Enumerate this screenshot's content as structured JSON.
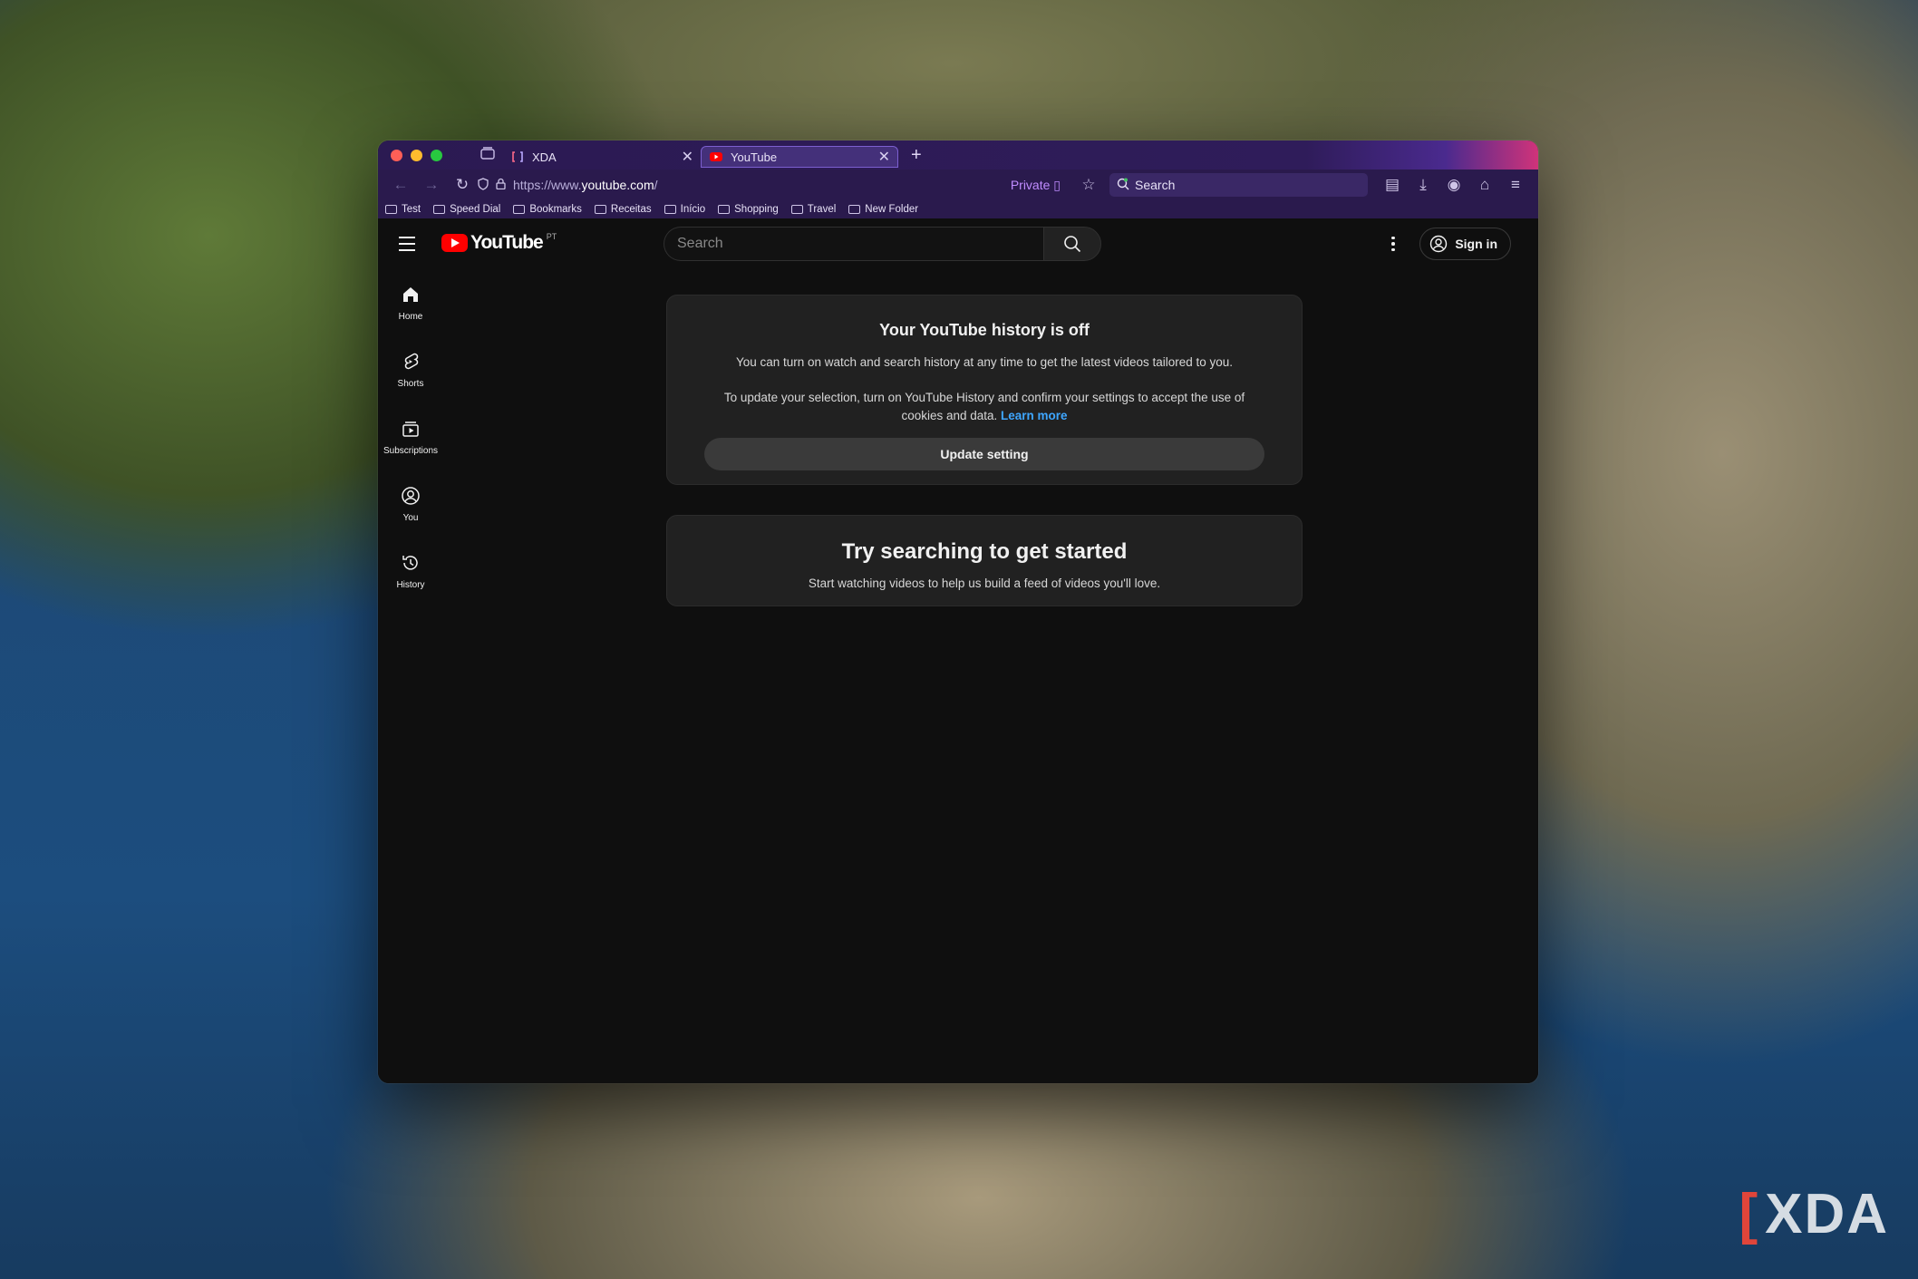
{
  "watermark": {
    "text": "XDA"
  },
  "browser": {
    "tabs": [
      {
        "title": "XDA",
        "active": false
      },
      {
        "title": "YouTube",
        "active": true
      }
    ],
    "url_prefix": "https://www.",
    "url_host": "youtube.com",
    "url_suffix": "/",
    "private_label": "Private",
    "search_placeholder": "Search",
    "bookmarks": [
      "Test",
      "Speed Dial",
      "Bookmarks",
      "Receitas",
      "Início",
      "Shopping",
      "Travel",
      "New Folder"
    ]
  },
  "youtube": {
    "logo_text": "YouTube",
    "country_code": "PT",
    "search_placeholder": "Search",
    "signin_label": "Sign in",
    "guide": [
      {
        "label": "Home",
        "icon": "home-icon"
      },
      {
        "label": "Shorts",
        "icon": "shorts-icon"
      },
      {
        "label": "Subscriptions",
        "icon": "subscriptions-icon"
      },
      {
        "label": "You",
        "icon": "you-icon"
      },
      {
        "label": "History",
        "icon": "history-icon"
      }
    ],
    "history_card": {
      "title": "Your YouTube history is off",
      "line1": "You can turn on watch and search history at any time to get the latest videos tailored to you.",
      "line2": "To update your selection, turn on YouTube History and confirm your settings to accept the use of cookies and data.",
      "learn_more": "Learn more",
      "button": "Update setting"
    },
    "start_card": {
      "title": "Try searching to get started",
      "body": "Start watching videos to help us build a feed of videos you'll love."
    }
  },
  "colors": {
    "accent_red": "#ff0000",
    "link_blue": "#3ea6ff",
    "browser_purple": "#2a1a4d"
  }
}
